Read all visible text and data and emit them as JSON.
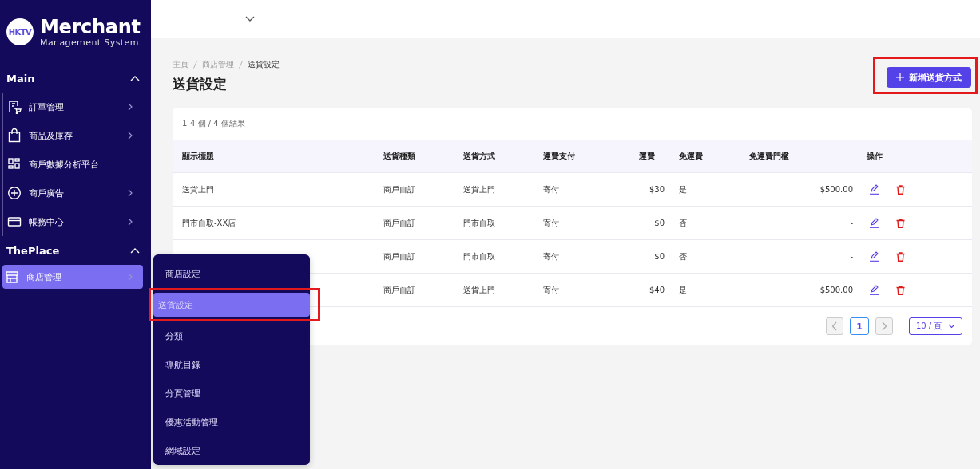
{
  "sidebar": {
    "logo": {
      "badge": "HKTV",
      "title": "Merchant",
      "subtitle": "Management System"
    },
    "sections": [
      {
        "title": "Main",
        "expanded": true,
        "items": [
          {
            "label": "訂單管理",
            "has_submenu": true,
            "selected": false
          },
          {
            "label": "商品及庫存",
            "has_submenu": true,
            "selected": false
          },
          {
            "label": "商戶數據分析平台",
            "has_submenu": false,
            "selected": false
          },
          {
            "label": "商戶廣告",
            "has_submenu": true,
            "selected": false
          },
          {
            "label": "帳務中心",
            "has_submenu": true,
            "selected": false
          }
        ]
      },
      {
        "title": "ThePlace",
        "expanded": true,
        "items": [
          {
            "label": "商店管理",
            "has_submenu": true,
            "selected": true
          }
        ]
      }
    ]
  },
  "breadcrumb": [
    "主頁",
    "商店管理",
    "送貨設定"
  ],
  "page_title": "送貨設定",
  "add_button": {
    "label": "新增送貨方式",
    "highlighted": true
  },
  "table": {
    "summary": "1-4 個 / 4 個結果",
    "columns": [
      "顯示標題",
      "送貨種類",
      "送貨方式",
      "運費支付",
      "運費",
      "免運費",
      "免運費門檻",
      "操作"
    ],
    "rows": [
      {
        "title": "送貨上門",
        "type": "商戶自訂",
        "method": "送貨上門",
        "payment": "寄付",
        "fee": "$30",
        "free_shipping": "是",
        "threshold": "$500.00"
      },
      {
        "title": "門市自取-XX店",
        "type": "商戶自訂",
        "method": "門市自取",
        "payment": "寄付",
        "fee": "$0",
        "free_shipping": "否",
        "threshold": "-"
      },
      {
        "type": "商戶自訂",
        "method": "門市自取",
        "payment": "寄付",
        "fee": "$0",
        "free_shipping": "否",
        "threshold": "-"
      },
      {
        "type": "商戶自訂",
        "method": "送貨上門",
        "payment": "寄付",
        "fee": "$40",
        "free_shipping": "是",
        "threshold": "$500.00"
      }
    ]
  },
  "pagination": {
    "page": "1",
    "prev_disabled": true,
    "next_disabled": true,
    "page_size": "10 / 頁"
  },
  "flyout": {
    "items": [
      {
        "label": "商店設定",
        "selected": false,
        "highlighted": false
      },
      {
        "label": "送貨設定",
        "selected": true,
        "highlighted": true
      },
      {
        "label": "分類",
        "selected": false,
        "highlighted": false
      },
      {
        "label": "導航目錄",
        "selected": false,
        "highlighted": false
      },
      {
        "label": "分頁管理",
        "selected": false,
        "highlighted": false
      },
      {
        "label": "優惠活動管理",
        "selected": false,
        "highlighted": false
      },
      {
        "label": "網域設定",
        "selected": false,
        "highlighted": false
      }
    ]
  }
}
